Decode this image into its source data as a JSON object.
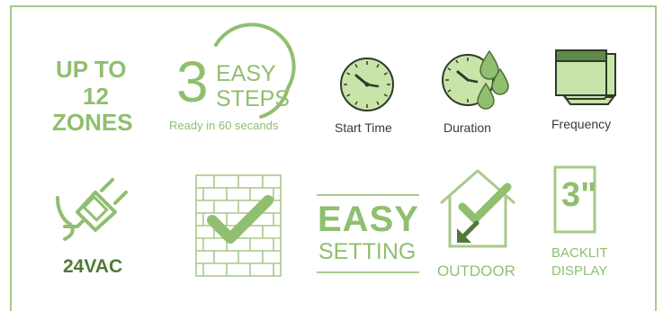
{
  "zones": {
    "line1": "UP TO",
    "line2": "12",
    "line3": "ZONES"
  },
  "steps": {
    "digit": "3",
    "word1": "EASY",
    "word2": "STEPS",
    "caption": "Ready in 60 secands"
  },
  "start_time": {
    "label": "Start Time",
    "icon": "clock-icon"
  },
  "duration": {
    "label": "Duration",
    "icon": "clock-water-drops-icon"
  },
  "frequency": {
    "label": "Frequency",
    "icon": "stacked-calendar-icon"
  },
  "power": {
    "label": "24VAC",
    "icon": "power-plug-icon"
  },
  "wall": {
    "icon": "brick-wall-check-icon"
  },
  "easy_setting": {
    "word1": "EASY",
    "word2": "SETTING"
  },
  "outdoor": {
    "label": "OUTDOOR",
    "icon": "house-check-arrow-icon"
  },
  "display": {
    "digit": "3\"",
    "line1": "BACKLIT",
    "line2": "DISPLAY",
    "icon": "display-icon"
  },
  "colors": {
    "green": "#8fbf6f",
    "dark_green": "#5f8a4a",
    "light_green": "#c9e4a8",
    "text_dark": "#3a3a3a",
    "border": "#a9c98a"
  }
}
